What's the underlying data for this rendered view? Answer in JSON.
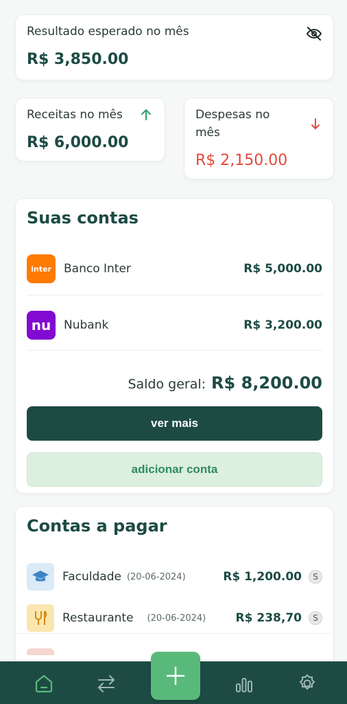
{
  "result_card": {
    "label": "Resultado esperado no mês",
    "value": "R$ 3,850.00"
  },
  "income_card": {
    "label": "Receitas no mês",
    "value": "R$ 6,000.00"
  },
  "expense_card": {
    "label_line1": "Despesas no",
    "label_line2": "mês",
    "value": "R$ 2,150.00"
  },
  "accounts": {
    "title": "Suas contas",
    "items": [
      {
        "name": "Banco Inter",
        "logo_text": "inter",
        "value": "R$ 5,000.00",
        "color": "#ff7a00"
      },
      {
        "name": "Nubank",
        "logo_text": "nu",
        "value": "R$ 3,200.00",
        "color": "#820ad1"
      }
    ],
    "total_label": "Saldo geral:",
    "total_value": "R$ 8,200.00",
    "more_button": "ver mais",
    "add_button": "adicionar conta"
  },
  "bills": {
    "title": "Contas a pagar",
    "items": [
      {
        "name": "Faculdade",
        "date": "(20-06-2024)",
        "value": "R$ 1,200.00",
        "coin": "S"
      },
      {
        "name": "Restaurante",
        "date": "(20-06-2024)",
        "value": "R$ 238,70",
        "coin": "S"
      }
    ]
  },
  "nav": {
    "items": [
      "home-icon",
      "transfer-icon",
      "chart-icon",
      "settings-icon"
    ],
    "fab": "plus-icon"
  },
  "colors": {
    "primary": "#1d4b44",
    "accent_green": "#59b97b",
    "up_green": "#2e9d6b",
    "down_red": "#e2483c"
  }
}
